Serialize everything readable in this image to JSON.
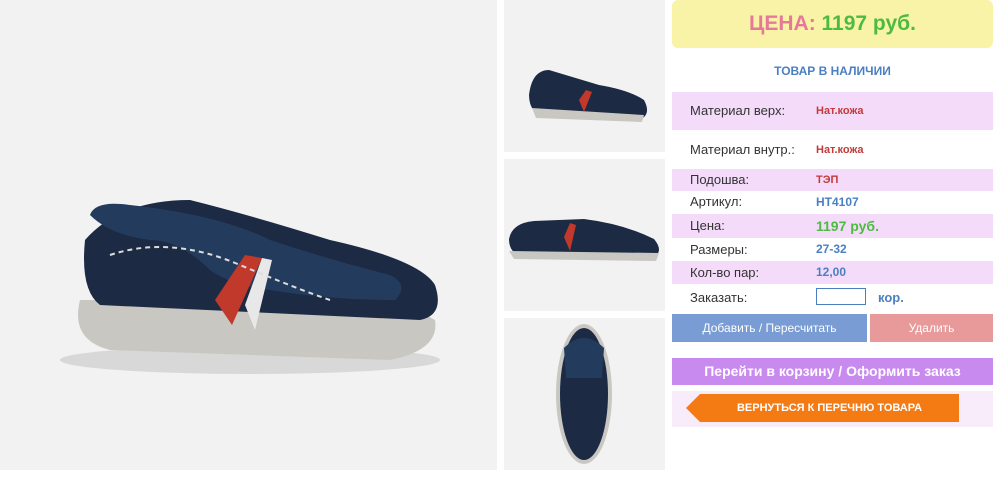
{
  "price": {
    "label": "ЦЕНА:",
    "value": "1197 руб."
  },
  "stock_status": "ТОВАР В НАЛИЧИИ",
  "specs": [
    {
      "label": "Материал верх:",
      "value": "Нат.кожа"
    },
    {
      "label": "Материал внутр.:",
      "value": "Нат.кожа"
    },
    {
      "label": "Подошва:",
      "value": "ТЭП"
    },
    {
      "label": "Артикул:",
      "value": "НТ4107"
    },
    {
      "label": "Цена:",
      "value": "1197 руб."
    },
    {
      "label": "Размеры:",
      "value": "27-32"
    },
    {
      "label": "Кол-во пар:",
      "value": "12,00"
    }
  ],
  "order": {
    "label": "Заказать:",
    "value": "",
    "unit": "кор."
  },
  "buttons": {
    "add": "Добавить / Пересчитать",
    "delete": "Удалить",
    "cart": "Перейти в корзину / Оформить заказ",
    "back": "ВЕРНУТЬСЯ К ПЕРЕЧНЮ ТОВАРА"
  },
  "colors": {
    "price_label": "#e57a98",
    "price_value": "#4dbb40",
    "stock": "#4a80c2",
    "row_highlight": "#f4dbfa",
    "cart_button": "#c98af0",
    "back_button": "#f47b14",
    "add_button": "#7a9cd4",
    "delete_button": "#e89a9a"
  }
}
